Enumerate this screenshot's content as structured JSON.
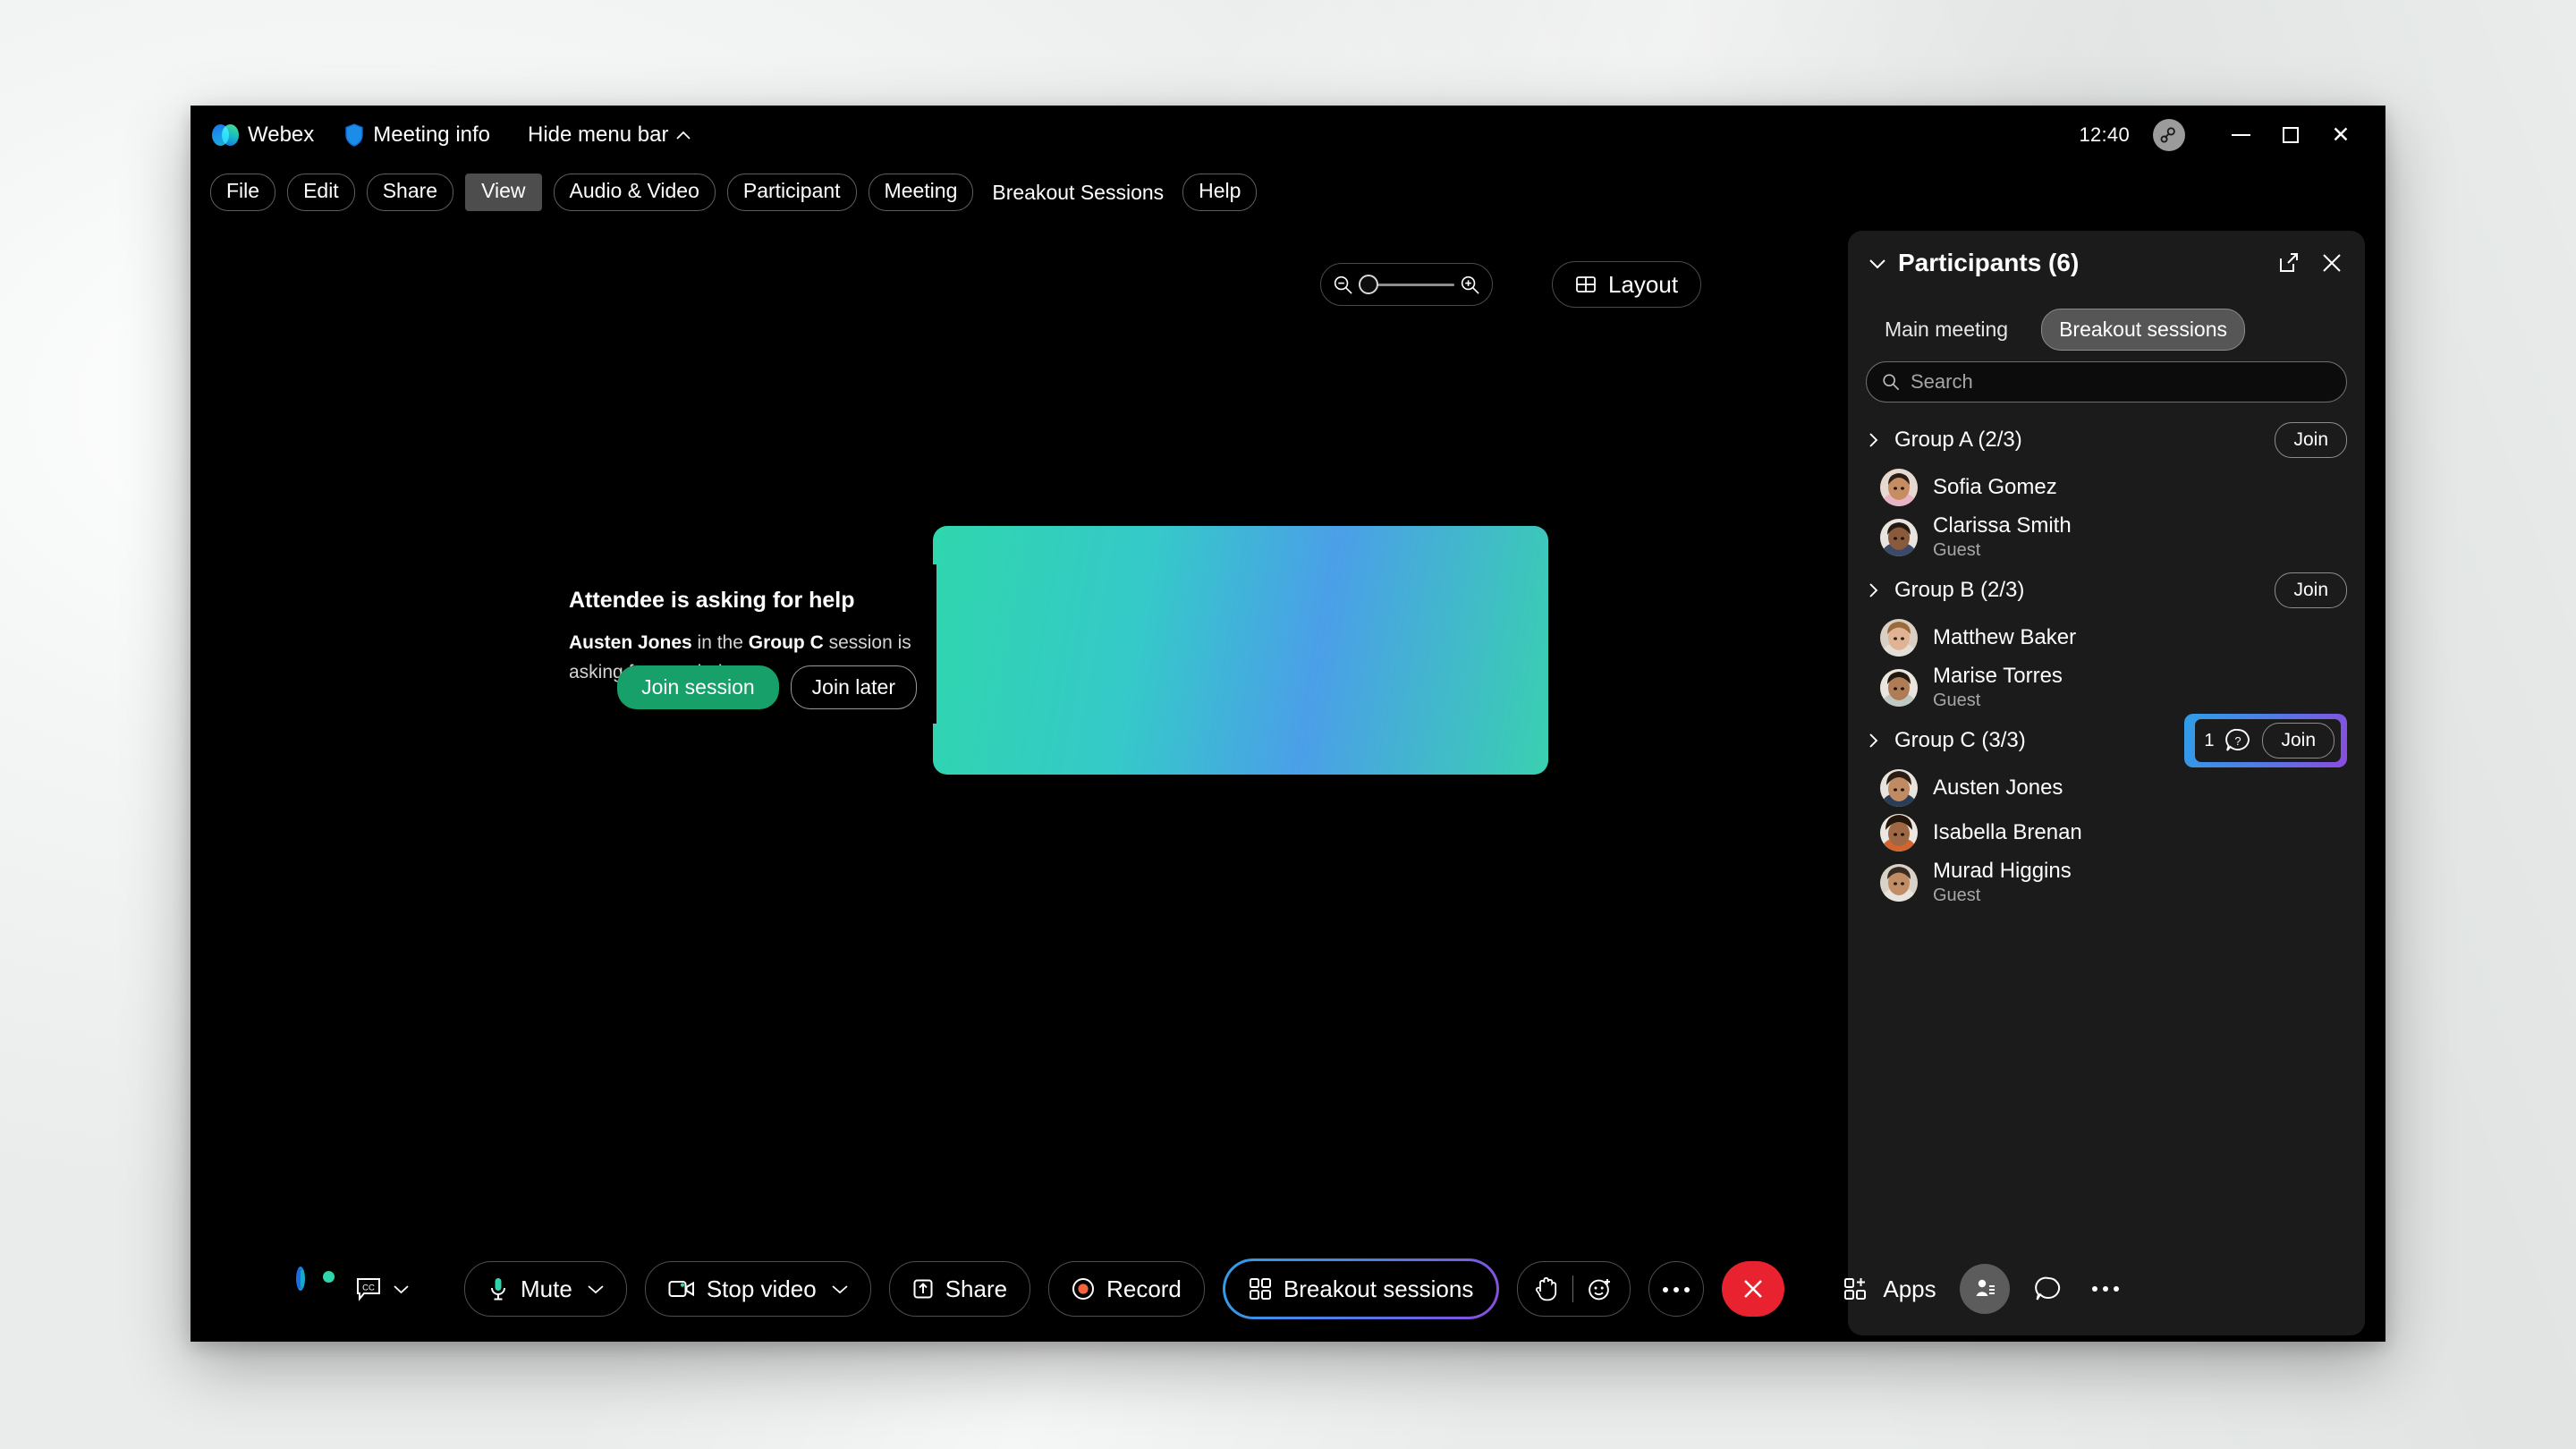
{
  "window": {
    "brand": "Webex",
    "meeting_info": "Meeting info",
    "hide_menu_bar": "Hide menu bar",
    "clock": "12:40",
    "icons": {
      "webex_logo": "webex-logo",
      "shield": "shield-icon",
      "chevron_up": "chevron-up-icon",
      "encryption_key": "key-icon",
      "minimize": "minimize-icon",
      "maximize": "maximize-icon",
      "close": "close-icon"
    }
  },
  "menubar": {
    "items": [
      {
        "label": "File",
        "active": false
      },
      {
        "label": "Edit",
        "active": false
      },
      {
        "label": "Share",
        "active": false
      },
      {
        "label": "View",
        "active": true
      },
      {
        "label": "Audio & Video",
        "active": false
      },
      {
        "label": "Participant",
        "active": false
      },
      {
        "label": "Meeting",
        "active": false
      }
    ],
    "plain_items": [
      {
        "label": "Breakout Sessions"
      }
    ],
    "help": "Help"
  },
  "viewcontrols": {
    "zoom_out_icon": "zoom-out-icon",
    "zoom_in_icon": "zoom-in-icon",
    "zoom_value": 0,
    "layout_label": "Layout",
    "layout_icon": "layout-grid-icon"
  },
  "stage": {
    "tiles": [
      {
        "id": "tile-1",
        "muted": false,
        "active": false
      },
      {
        "id": "tile-2",
        "muted": true,
        "active": false
      },
      {
        "id": "tile-3",
        "muted": false,
        "active": false
      },
      {
        "id": "tile-4",
        "muted": false,
        "active": true
      },
      {
        "id": "tile-5",
        "muted": true,
        "active": false
      },
      {
        "id": "tile-6",
        "muted": false,
        "active": false
      }
    ],
    "mute_icon": "microphone-muted-icon",
    "active_speaker_border_color": "#2fd6ad"
  },
  "dialog": {
    "title": "Attendee is asking for help",
    "body_before": "",
    "body_name": "Austen Jones",
    "body_mid": " in the ",
    "body_group": "Group C",
    "body_after": " session is asking for your help.",
    "primary_button": "Join session",
    "secondary_button": "Join later",
    "primary_color": "#17a06a"
  },
  "panel": {
    "title": "Participants (6)",
    "collapse_icon": "chevron-down-icon",
    "popout_icon": "popout-icon",
    "close_icon": "close-icon",
    "tabs": [
      {
        "label": "Main meeting",
        "active": false
      },
      {
        "label": "Breakout sessions",
        "active": true
      }
    ],
    "search": {
      "placeholder": "Search",
      "value": "",
      "icon": "search-icon"
    },
    "groups": [
      {
        "name": "Group A (2/3)",
        "join_label": "Join",
        "help_count": null,
        "highlighted": false,
        "members": [
          {
            "name": "Sofia Gomez",
            "role": ""
          },
          {
            "name": "Clarissa Smith",
            "role": "Guest"
          }
        ]
      },
      {
        "name": "Group B (2/3)",
        "join_label": "Join",
        "help_count": null,
        "highlighted": false,
        "members": [
          {
            "name": "Matthew Baker",
            "role": ""
          },
          {
            "name": "Marise Torres",
            "role": "Guest"
          }
        ]
      },
      {
        "name": "Group C (3/3)",
        "join_label": "Join",
        "help_count": "1",
        "help_icon": "question-bubble-icon",
        "highlighted": true,
        "members": [
          {
            "name": "Austen Jones",
            "role": ""
          },
          {
            "name": "Isabella Brenan",
            "role": ""
          },
          {
            "name": "Murad Higgins",
            "role": "Guest"
          }
        ]
      }
    ]
  },
  "toolbar": {
    "assistant_icon": "ai-assistant-icon",
    "captions_icon": "closed-captions-icon",
    "captions_chevron_icon": "chevron-down-icon",
    "mute_label": "Mute",
    "mute_icon": "microphone-icon",
    "video_label": "Stop video",
    "video_icon": "camera-icon",
    "share_label": "Share",
    "share_icon": "share-screen-icon",
    "record_label": "Record",
    "record_icon": "record-icon",
    "breakout_label": "Breakout sessions",
    "breakout_icon": "breakout-grid-icon",
    "reactions_hand_icon": "raise-hand-icon",
    "reactions_emoji_icon": "emoji-icon",
    "more_icon": "more-options-icon",
    "leave_icon": "leave-meeting-icon",
    "apps_label": "Apps",
    "apps_icon": "apps-icon",
    "participants_icon": "participants-icon",
    "chat_icon": "chat-bubble-icon",
    "overflow_icon": "more-options-icon",
    "leave_color": "#e8232f"
  },
  "cursor": {
    "name": "mouse-pointer"
  }
}
